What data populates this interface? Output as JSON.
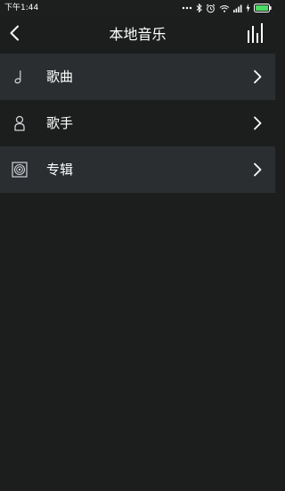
{
  "status_bar": {
    "time": "下午1:44"
  },
  "header": {
    "title": "本地音乐",
    "back_icon": "chevron-left-icon",
    "equalizer_icon": "equalizer-icon"
  },
  "menu": {
    "items": [
      {
        "label": "歌曲",
        "icon": "music-note-icon"
      },
      {
        "label": "歌手",
        "icon": "person-icon"
      },
      {
        "label": "专辑",
        "icon": "album-icon"
      }
    ]
  },
  "colors": {
    "background": "#1c1e1e",
    "row_highlight": "#2a2e31",
    "battery": "#4cd964",
    "text": "#ffffff"
  }
}
